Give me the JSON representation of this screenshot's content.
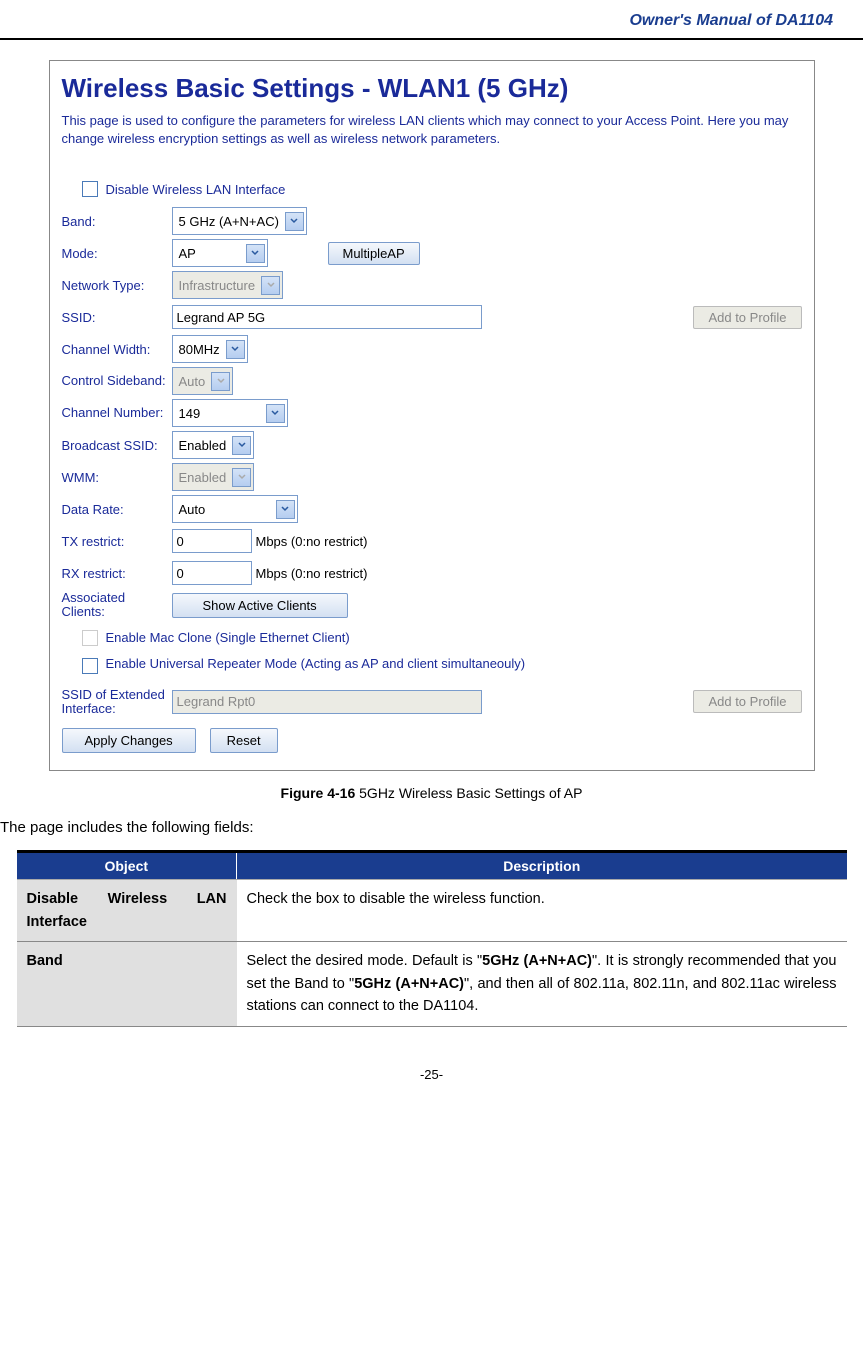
{
  "header": "Owner's Manual of DA1104",
  "screenshot": {
    "title": "Wireless Basic Settings - WLAN1 (5 GHz)",
    "intro": "This page is used to configure the parameters for wireless LAN clients which may connect to your Access Point. Here you may change wireless encryption settings as well as wireless network parameters.",
    "disable_chk": "Disable Wireless LAN Interface",
    "band": {
      "label": "Band:",
      "value": "5 GHz (A+N+AC)"
    },
    "mode": {
      "label": "Mode:",
      "value": "AP",
      "button": "MultipleAP"
    },
    "nettype": {
      "label": "Network Type:",
      "value": "Infrastructure"
    },
    "ssid": {
      "label": "SSID:",
      "value": "Legrand AP 5G",
      "button": "Add to Profile"
    },
    "chwidth": {
      "label": "Channel Width:",
      "value": "80MHz"
    },
    "sideband": {
      "label": "Control Sideband:",
      "value": "Auto"
    },
    "chnum": {
      "label": "Channel Number:",
      "value": "149"
    },
    "bcast": {
      "label": "Broadcast SSID:",
      "value": "Enabled"
    },
    "wmm": {
      "label": "WMM:",
      "value": "Enabled"
    },
    "datarate": {
      "label": "Data Rate:",
      "value": "Auto"
    },
    "tx": {
      "label": "TX restrict:",
      "value": "0",
      "hint": "Mbps (0:no restrict)"
    },
    "rx": {
      "label": "RX restrict:",
      "value": "0",
      "hint": "Mbps (0:no restrict)"
    },
    "assoc": {
      "label": "Associated Clients:",
      "button": "Show Active Clients"
    },
    "macclone": "Enable Mac Clone (Single Ethernet Client)",
    "repeater": "Enable Universal Repeater Mode (Acting as AP and client simultaneouly)",
    "extssid": {
      "label": "SSID of Extended Interface:",
      "value": "Legrand Rpt0",
      "button": "Add to Profile"
    },
    "apply": "Apply Changes",
    "reset": "Reset"
  },
  "caption": {
    "fig": "Figure 4-16",
    "text": " 5GHz Wireless Basic Settings of AP"
  },
  "intro_text": "The page includes the following fields:",
  "table": {
    "h1": "Object",
    "h2": "Description",
    "rows": [
      {
        "obj": "Disable Wireless LAN Interface",
        "desc_parts": [
          "Check the box to disable the wireless function."
        ]
      },
      {
        "obj": "Band",
        "desc_parts": [
          "Select the desired mode. Default is \"",
          "5GHz (A+N+AC)",
          "\". It is strongly recommended that you set the Band to \"",
          "5GHz (A+N+AC)",
          "\", and then all of 802.11a, 802.11n, and 802.11ac wireless stations can connect to the DA1104."
        ],
        "bold": [
          1,
          3
        ]
      }
    ]
  },
  "footer": "-25-"
}
